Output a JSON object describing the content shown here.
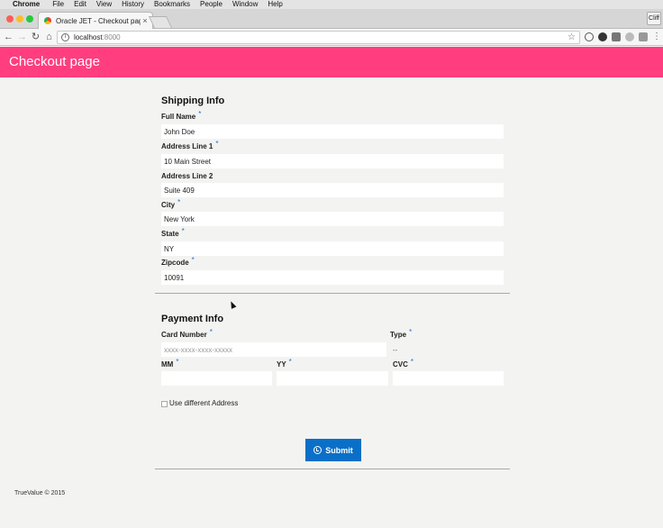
{
  "menubar": {
    "app": "Chrome",
    "items": [
      "File",
      "Edit",
      "View",
      "History",
      "Bookmarks",
      "People",
      "Window",
      "Help"
    ]
  },
  "browser": {
    "tab_title": "Oracle JET - Checkout page",
    "tab_close": "×",
    "profile": "Cliff",
    "url_host": "localhost",
    "url_port": ":8000"
  },
  "header": {
    "title": "Checkout page"
  },
  "shipping": {
    "title": "Shipping Info",
    "full_name": {
      "label": "Full Name",
      "value": "John Doe",
      "required": true
    },
    "address1": {
      "label": "Address Line 1",
      "value": "10 Main Street",
      "required": true
    },
    "address2": {
      "label": "Address Line 2",
      "value": "Suite 409",
      "required": false
    },
    "city": {
      "label": "City",
      "value": "New York",
      "required": true
    },
    "state": {
      "label": "State",
      "value": "NY",
      "required": true
    },
    "zipcode": {
      "label": "Zipcode",
      "value": "10091",
      "required": true
    }
  },
  "payment": {
    "title": "Payment Info",
    "card_number": {
      "label": "Card Number",
      "placeholder": "xxxx-xxxx-xxxx-xxxxx",
      "required": true
    },
    "type": {
      "label": "Type",
      "value": "--",
      "required": true
    },
    "mm": {
      "label": "MM",
      "required": true
    },
    "yy": {
      "label": "YY",
      "required": true
    },
    "cvc": {
      "label": "CVC",
      "required": true
    },
    "use_different_address": "Use different Address"
  },
  "required_marker": "*",
  "submit_label": "Submit",
  "footer": "TrueValue © 2015",
  "colors": {
    "header": "#ff3d7f",
    "submit": "#0a6fc7",
    "required": "#1d6fd1"
  }
}
